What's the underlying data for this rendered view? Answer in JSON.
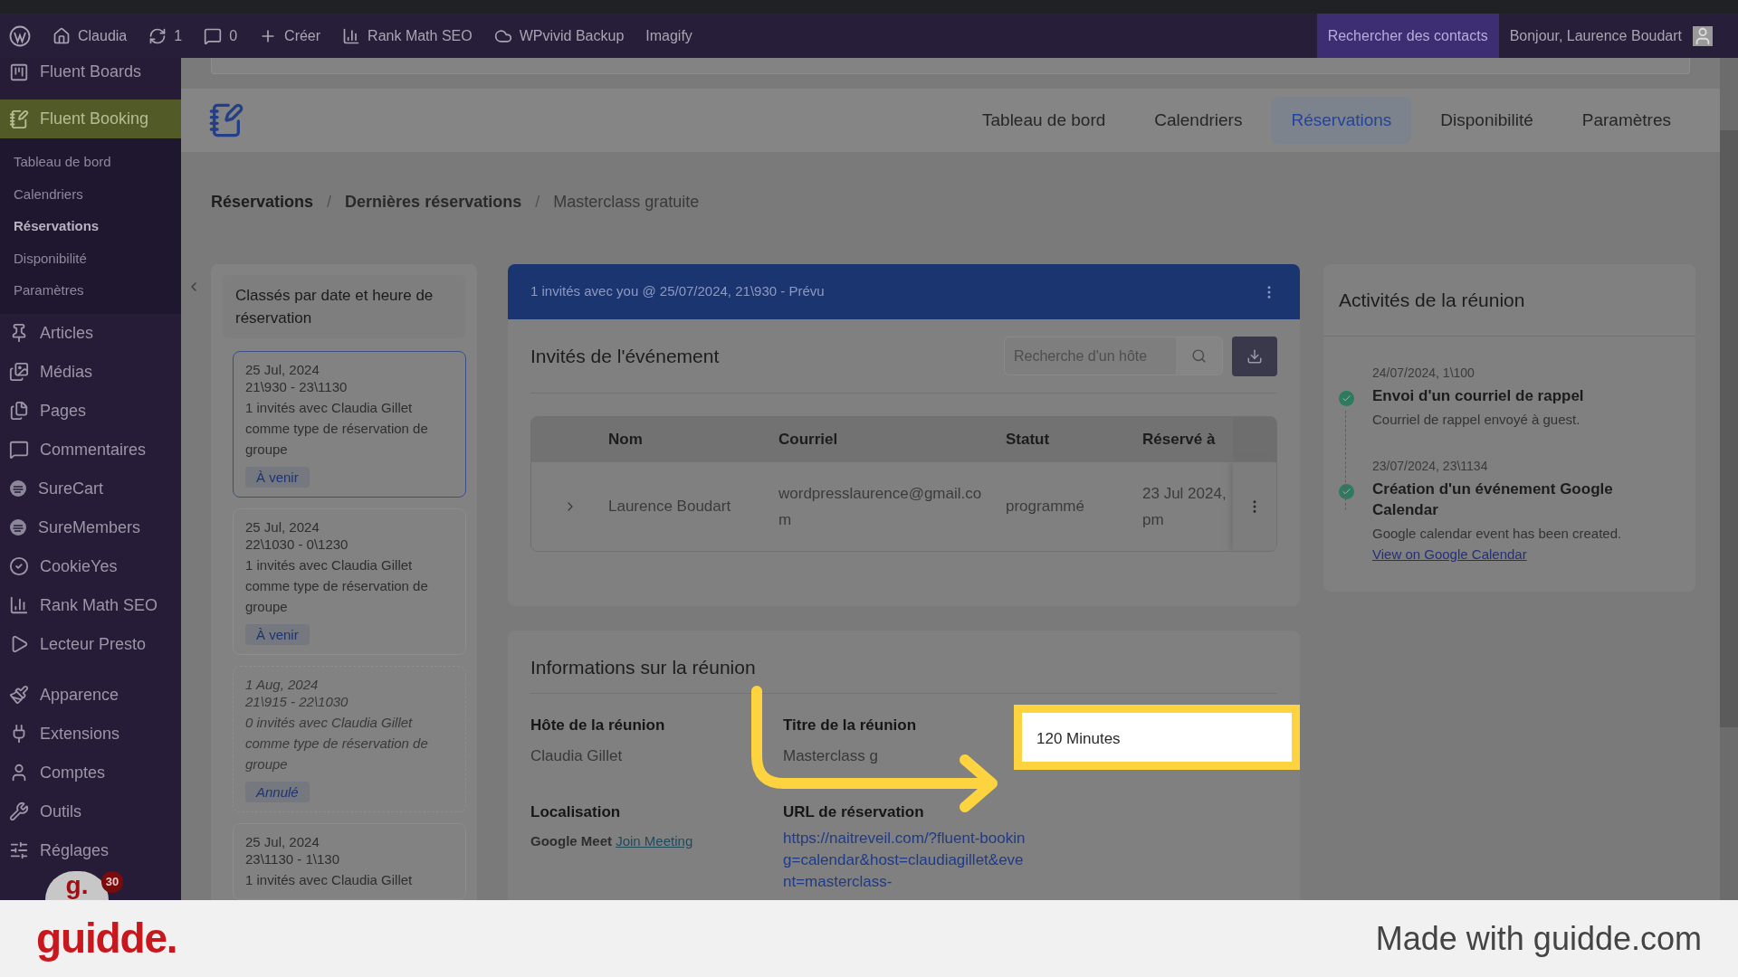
{
  "admin_bar": {
    "items": [
      {
        "kind": "wordpress"
      },
      {
        "kind": "home",
        "label": "Claudia"
      },
      {
        "kind": "updates",
        "label": "1"
      },
      {
        "kind": "comments",
        "label": "0"
      },
      {
        "kind": "new",
        "label": "Créer"
      },
      {
        "kind": "chart",
        "label": "Rank Math SEO"
      },
      {
        "kind": "cloud",
        "label": "WPvivid Backup"
      },
      {
        "kind": "text",
        "label": "Imagify"
      }
    ],
    "search_contacts": "Rechercher des contacts",
    "greeting": "Bonjour, Laurence Boudart"
  },
  "sidebar": {
    "groups": [
      [
        {
          "label": "Fluent Boards",
          "selected": false
        },
        {
          "label": "Fluent Booking",
          "selected": true,
          "children": [
            {
              "label": "Tableau de bord",
              "selected": false
            },
            {
              "label": "Calendriers",
              "selected": false
            },
            {
              "label": "Réservations",
              "selected": true
            },
            {
              "label": "Disponibilité",
              "selected": false
            },
            {
              "label": "Paramètres",
              "selected": false
            }
          ]
        },
        {
          "label": "Articles",
          "selected": false
        },
        {
          "label": "Médias",
          "selected": false
        },
        {
          "label": "Pages",
          "selected": false
        },
        {
          "label": "Commentaires",
          "selected": false
        },
        {
          "label": "SureCart",
          "selected": false
        },
        {
          "label": "SureMembers",
          "selected": false
        },
        {
          "label": "CookieYes",
          "selected": false
        },
        {
          "label": "Rank Math SEO",
          "selected": false
        },
        {
          "label": "Lecteur Presto",
          "selected": false
        }
      ],
      [
        {
          "label": "Apparence",
          "selected": false
        },
        {
          "label": "Extensions",
          "selected": false
        },
        {
          "label": "Comptes",
          "selected": false
        },
        {
          "label": "Outils",
          "selected": false
        },
        {
          "label": "Réglages",
          "selected": false
        }
      ]
    ]
  },
  "nav_tabs": [
    {
      "label": "Tableau de bord",
      "selected": false
    },
    {
      "label": "Calendriers",
      "selected": false
    },
    {
      "label": "Réservations",
      "selected": true
    },
    {
      "label": "Disponibilité",
      "selected": false
    },
    {
      "label": "Paramètres",
      "selected": false
    }
  ],
  "breadcrumb": {
    "separator": "/",
    "items": [
      "Réservations",
      "Dernières réservations",
      "Masterclass gratuite"
    ]
  },
  "bookings_panel": {
    "title": "Classés par date et heure de réservation",
    "items": [
      {
        "date": "25 Jul, 2024",
        "time": "21\\930 - 23\\1130",
        "description": "1 invités avec Claudia Gillet comme type de réservation de groupe",
        "badge": "À venir",
        "selected": true,
        "cancelled": false
      },
      {
        "date": "25 Jul, 2024",
        "time": "22\\1030 - 0\\1230",
        "description": "1 invités avec Claudia Gillet comme type de réservation de groupe",
        "badge": "À venir",
        "selected": false,
        "cancelled": false
      },
      {
        "date": "1 Aug, 2024",
        "time": "21\\915 - 22\\1030",
        "description": "0 invités avec Claudia Gillet comme type de réservation de groupe",
        "badge": "Annulé",
        "selected": false,
        "cancelled": true
      },
      {
        "date": "25 Jul, 2024",
        "time": "23\\1130 - 1\\130",
        "description": "1 invités avec Claudia Gillet",
        "selected": false,
        "cancelled": false
      }
    ]
  },
  "banner": "1 invités avec you @ 25/07/2024, 21\\930 - Prévu",
  "guests": {
    "title": "Invités de l'événement",
    "search": {
      "placeholder": "Recherche d'un hôte"
    },
    "columns": [
      "Nom",
      "Courriel",
      "Statut",
      "Réservé à"
    ],
    "rows": [
      {
        "name": "Laurence Boudart",
        "email": "wordpresslaurence@gmail.com",
        "status": "programmé",
        "reserved_lines": [
          "23 Jul 2024,",
          "pm"
        ]
      }
    ]
  },
  "meeting_info": {
    "title": "Informations sur la réunion",
    "fields": [
      {
        "label": "Hôte de la réunion",
        "value": "Claudia Gillet"
      },
      {
        "label": "Titre de la réunion",
        "value": "Masterclass g"
      },
      {
        "label": "Localisation",
        "value": "Google Meet",
        "link": "Join Meeting"
      },
      {
        "label": "URL de réservation",
        "url": "https://naitreveil.com/?fluent-booking=calendar&host=claudiagillet&event=masterclass-"
      }
    ],
    "highlighted_value": "120 Minutes"
  },
  "activities": {
    "title": "Activités de la réunion",
    "items": [
      {
        "time": "24/07/2024, 1\\100",
        "title": "Envoi d'un courriel de rappel",
        "description": "Courriel de rappel envoyé à guest."
      },
      {
        "time": "23/07/2024, 23\\1134",
        "title": "Création d'un événement Google Calendar",
        "description": "Google calendar event has been created.",
        "link": "View on Google Calendar"
      }
    ]
  },
  "recorder_badge": {
    "logo": "g.",
    "count": "30"
  },
  "footer": {
    "logo": "guidde.",
    "credit": "Made with guidde.com"
  }
}
